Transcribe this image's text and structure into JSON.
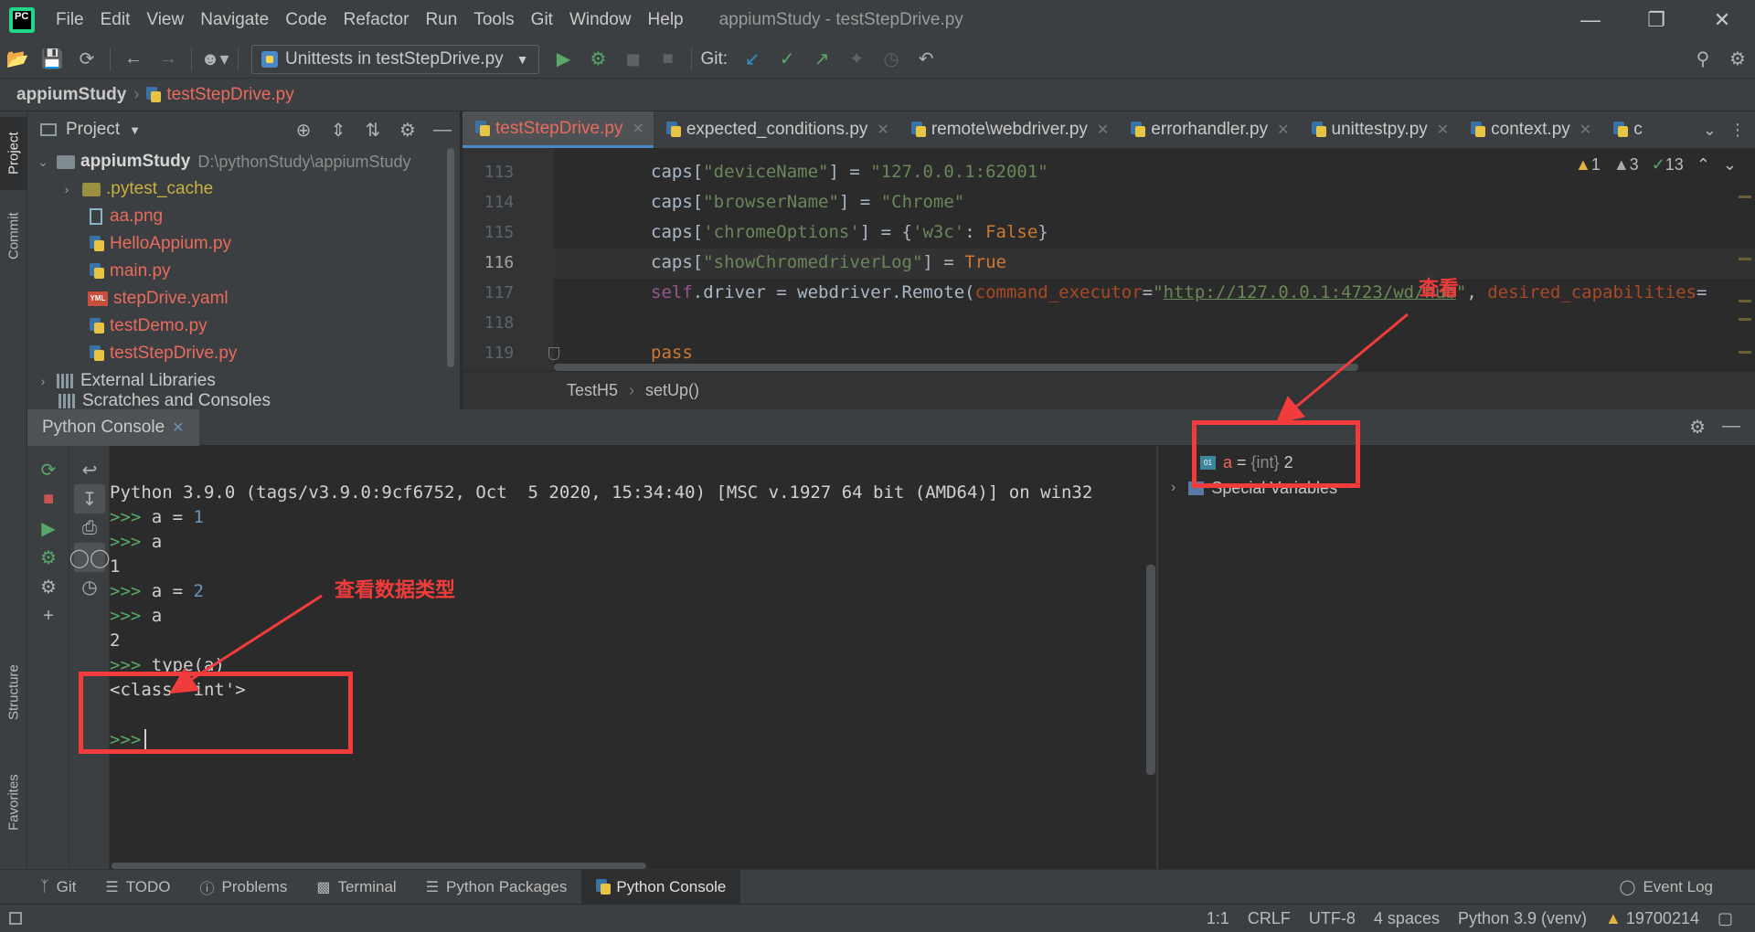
{
  "app": {
    "logo_text": "PC",
    "window_title": "appiumStudy - testStepDrive.py",
    "menu": [
      "File",
      "Edit",
      "View",
      "Navigate",
      "Code",
      "Refactor",
      "Run",
      "Tools",
      "Git",
      "Window",
      "Help"
    ]
  },
  "toolbar": {
    "run_config": "Unittests in testStepDrive.py",
    "git_label": "Git:"
  },
  "breadcrumb": {
    "project": "appiumStudy",
    "file": "testStepDrive.py"
  },
  "left_stripe": {
    "tabs": [
      "Project",
      "Commit",
      "Structure",
      "Favorites"
    ]
  },
  "project_panel": {
    "title": "Project",
    "root_name": "appiumStudy",
    "root_path": "D:\\pythonStudy\\appiumStudy",
    "items": [
      {
        "name": ".pytest_cache",
        "kind": "folder"
      },
      {
        "name": "aa.png",
        "kind": "image"
      },
      {
        "name": "HelloAppium.py",
        "kind": "py"
      },
      {
        "name": "main.py",
        "kind": "py"
      },
      {
        "name": "stepDrive.yaml",
        "kind": "yaml"
      },
      {
        "name": "testDemo.py",
        "kind": "py"
      },
      {
        "name": "testStepDrive.py",
        "kind": "py"
      }
    ],
    "external_libraries": "External Libraries",
    "scratches": "Scratches and Consoles"
  },
  "editor": {
    "tabs": [
      "testStepDrive.py",
      "expected_conditions.py",
      "remote\\webdriver.py",
      "errorhandler.py",
      "unittestpy.py",
      "context.py",
      "c"
    ],
    "inspections": {
      "warnings": "1",
      "weak_warnings": "3",
      "typos": "13"
    },
    "line_numbers": [
      "113",
      "114",
      "115",
      "116",
      "117",
      "118",
      "119"
    ],
    "lines": {
      "l113": {
        "a": "caps[",
        "b": "\"deviceName\"",
        "c": "] = ",
        "d": "\"127.0.0.1:62001\""
      },
      "l114": {
        "a": "caps[",
        "b": "\"browserName\"",
        "c": "] = ",
        "d": "\"Chrome\""
      },
      "l115": {
        "a": "caps[",
        "b": "'chromeOptions'",
        "c": "] = {",
        "d": "'w3c'",
        "e": ": ",
        "f": "False",
        "g": "}"
      },
      "l116": {
        "a": "caps[",
        "b": "\"showChromedriverLog\"",
        "c": "] = ",
        "d": "True"
      },
      "l117": {
        "a": "self",
        "b": ".driver = webdriver.Remote(",
        "c": "command_executor",
        "d": "=",
        "e": "\"",
        "f": "http://127.0.0.1:4723/wd/hub",
        "g": "\"",
        "h": ", ",
        "i": "desired_capabilities",
        "j": "="
      },
      "l119": {
        "a": "pass"
      }
    },
    "crumbs": [
      "TestH5",
      "setUp()"
    ]
  },
  "console": {
    "tab_label": "Python Console",
    "lines": {
      "banner": "Python 3.9.0 (tags/v3.9.0:9cf6752, Oct  5 2020, 15:34:40) [MSC v.1927 64 bit (AMD64)] on win32",
      "prompt": ">>>",
      "c1_a": "a = ",
      "c1_b": "1",
      "c2": "a",
      "o2": "1",
      "c3_a": "a = ",
      "c3_b": "2",
      "c4": "a",
      "o4": "2",
      "c5": "type(a)",
      "o5": "<class 'int'>"
    }
  },
  "variables": {
    "a_icon": "01",
    "a_name": "a",
    "a_eq": " = ",
    "a_type": "{int} ",
    "a_value": "2",
    "special": "Special Variables"
  },
  "bottom_tabs": [
    "Git",
    "TODO",
    "Problems",
    "Terminal",
    "Python Packages",
    "Python Console"
  ],
  "event_log": "Event Log",
  "status": {
    "position": "1:1",
    "line_sep": "CRLF",
    "encoding": "UTF-8",
    "indent": "4 spaces",
    "interpreter": "Python 3.9 (venv)",
    "id": "19700214"
  },
  "annotations": {
    "view_label": "查看",
    "type_label": "查看数据类型",
    "color": "#f23b3b"
  }
}
